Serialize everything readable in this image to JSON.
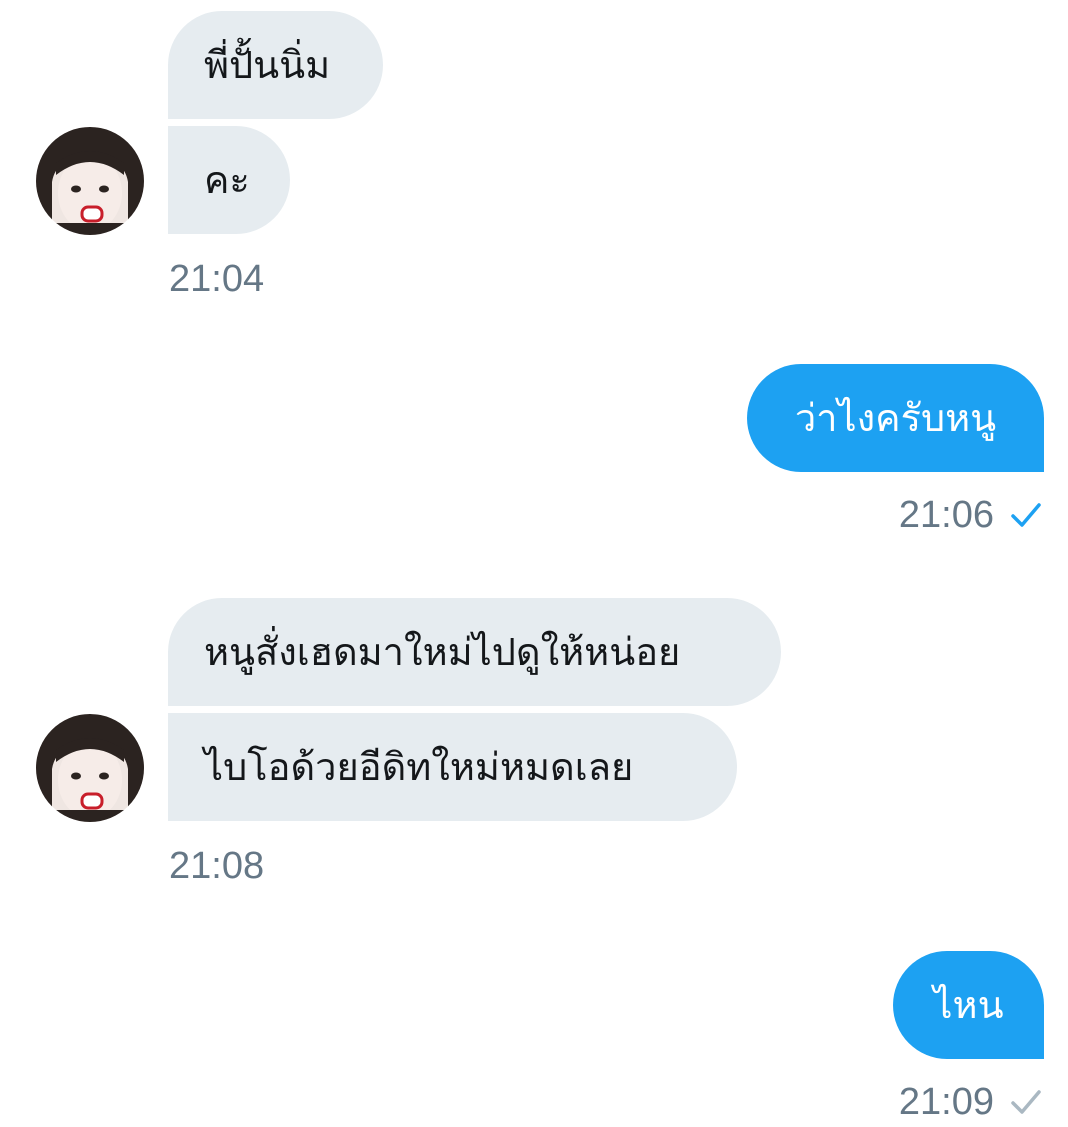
{
  "conversation": {
    "group1": {
      "messages": [
        "พี่ปั้นนิ่ม",
        "คะ"
      ],
      "time": "21:04"
    },
    "reply1": {
      "text": "ว่าไงครับหนู",
      "time": "21:06",
      "status_icon": "check-icon",
      "status_color": "#1da1f2"
    },
    "group2": {
      "messages": [
        "หนูสั่งเฮดมาใหม่ไปดูให้หน่อย",
        "ไบโอด้วยอีดิทใหม่หมดเลย"
      ],
      "time": "21:08"
    },
    "reply2": {
      "text": "ไหน",
      "time": "21:09",
      "status_icon": "check-icon",
      "status_color": "#aab8c2"
    }
  },
  "colors": {
    "incoming_bubble": "#e6ecf0",
    "outgoing_bubble": "#1da1f2",
    "timestamp": "#657786"
  }
}
